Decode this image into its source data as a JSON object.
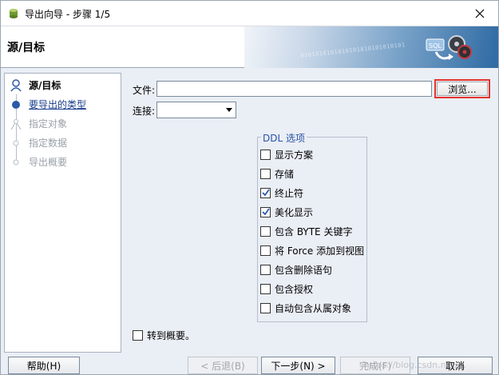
{
  "window": {
    "title": "导出向导 - 步骤 1/5",
    "icon": "database-export-icon",
    "close_icon": "close-icon"
  },
  "header": {
    "title": "源/目标",
    "banner_bits": "0101010101010101010101010101",
    "banner_icon": "sql-export-icon"
  },
  "steps": [
    {
      "label": "源/目标",
      "state": "active"
    },
    {
      "label": "要导出的类型",
      "state": "link"
    },
    {
      "label": "指定对象",
      "state": "disabled"
    },
    {
      "label": "指定数据",
      "state": "disabled"
    },
    {
      "label": "导出概要",
      "state": "disabled"
    }
  ],
  "main": {
    "file_label": "文件:",
    "file_value": "",
    "browse_label": "浏览...",
    "connection_label": "连接:",
    "connection_value": "",
    "ddl_legend": "DDL 选项",
    "options": [
      {
        "label": "显示方案",
        "checked": false
      },
      {
        "label": "存储",
        "checked": false
      },
      {
        "label": "终止符",
        "checked": true
      },
      {
        "label": "美化显示",
        "checked": true
      },
      {
        "label": "包含 BYTE 关键字",
        "checked": false
      },
      {
        "label": "将 Force 添加到视图",
        "checked": false
      },
      {
        "label": "包含删除语句",
        "checked": false
      },
      {
        "label": "包含授权",
        "checked": false
      },
      {
        "label": "自动包含从属对象",
        "checked": false
      }
    ],
    "goto_summary": {
      "label": "转到概要。",
      "checked": false
    }
  },
  "footer": {
    "help": "帮助(H)",
    "back": "< 后退(B)",
    "next": "下一步(N) >",
    "finish": "完成(F)",
    "cancel": "取消",
    "watermark": "https://blog.csdn.net/..."
  },
  "colors": {
    "highlight_border": "#e3342f",
    "legend_text": "#2a52a8",
    "link_text": "#1a3c8c"
  }
}
